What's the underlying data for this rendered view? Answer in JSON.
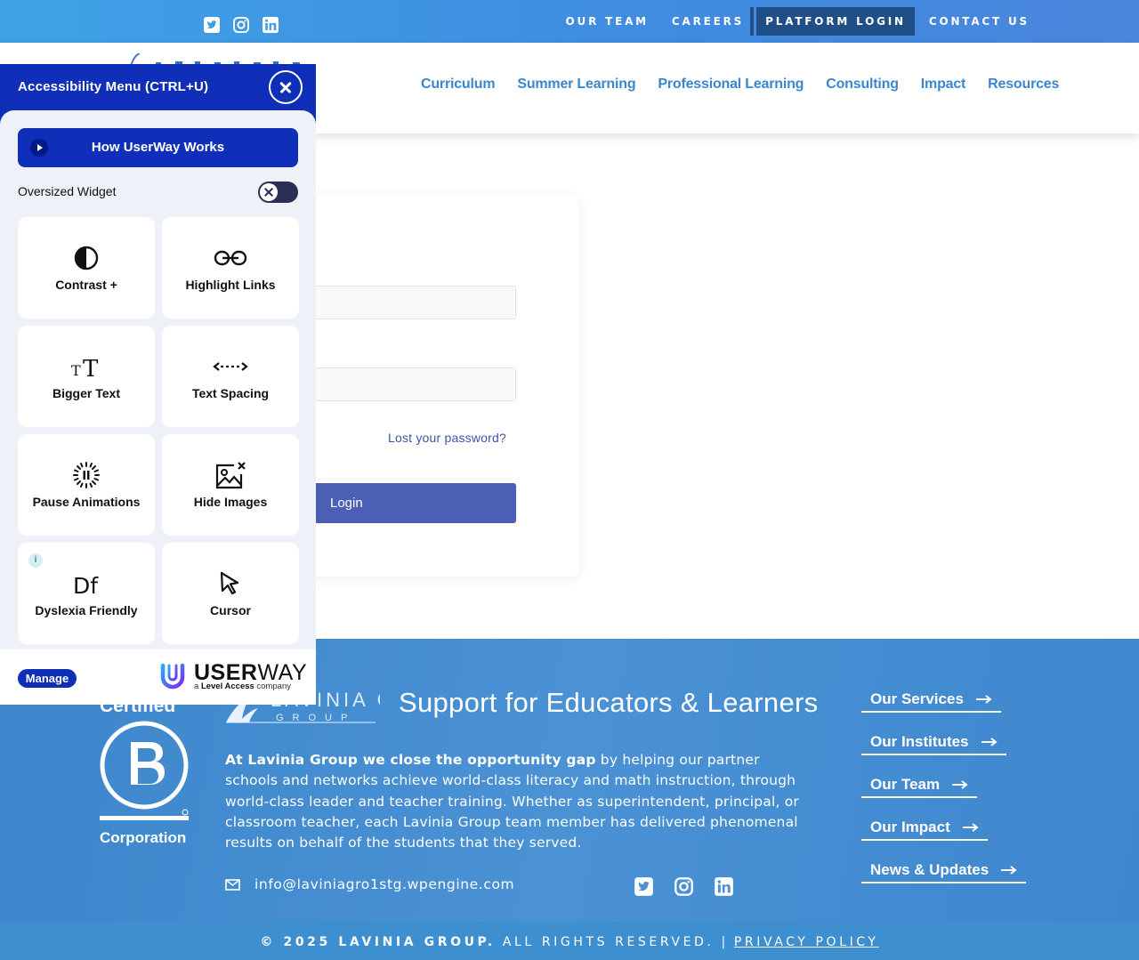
{
  "top_bar": {
    "social": [
      "twitter-icon",
      "instagram-icon",
      "linkedin-icon"
    ],
    "links": [
      "OUR TEAM",
      "CAREERS",
      "PLATFORM LOGIN",
      "CONTACT US"
    ]
  },
  "main_nav": [
    "Curriculum",
    "Summer Learning",
    "Professional Learning",
    "Consulting",
    "Impact",
    "Resources"
  ],
  "login": {
    "lost_password": "Lost your password?",
    "button": "Login"
  },
  "footer": {
    "b_corp": {
      "top": "Certified",
      "bottom": "Corporation"
    },
    "logo": "LAVINIA GROUP",
    "tagline": "Support for Educators & Learners",
    "about_bold": "At Lavinia Group we close the opportunity gap",
    "about_rest": " by helping our partner schools and networks achieve world-class literacy and math instruction, through world-class leader and teacher training.  Whether as superintendent, principal, or classroom teacher, each Lavinia Group team member has delivered phenomenal results on behalf of the students that they served.",
    "email": "info@laviniagro1stg.wpengine.com",
    "links": [
      "Our Services",
      "Our Institutes",
      "Our Team",
      "Our Impact",
      "News & Updates"
    ],
    "copyright_bold": "© 2025 LAVINIA GROUP.",
    "copyright_rest": " ALL RIGHTS RESERVED. |",
    "privacy": "PRIVACY POLICY"
  },
  "userway": {
    "title": "Accessibility Menu (CTRL+U)",
    "how_button": "How UserWay Works",
    "oversized_label": "Oversized Widget",
    "oversized_on": false,
    "tiles": [
      {
        "label": "Contrast +",
        "icon": "contrast-icon"
      },
      {
        "label": "Highlight Links",
        "icon": "link-icon"
      },
      {
        "label": "Bigger Text",
        "icon": "text-size-icon"
      },
      {
        "label": "Text Spacing",
        "icon": "text-spacing-icon"
      },
      {
        "label": "Pause Animations",
        "icon": "pause-animations-icon"
      },
      {
        "label": "Hide Images",
        "icon": "hide-images-icon"
      },
      {
        "label": "Dyslexia Friendly",
        "icon": "dyslexia-icon"
      },
      {
        "label": "Cursor",
        "icon": "cursor-icon"
      }
    ],
    "info_badge": "i",
    "manage": "Manage",
    "brand_bold": "USER",
    "brand_light": "WAY",
    "brand_sub_pre": "a ",
    "brand_sub_bold": "Level Access",
    "brand_sub_post": " company"
  }
}
